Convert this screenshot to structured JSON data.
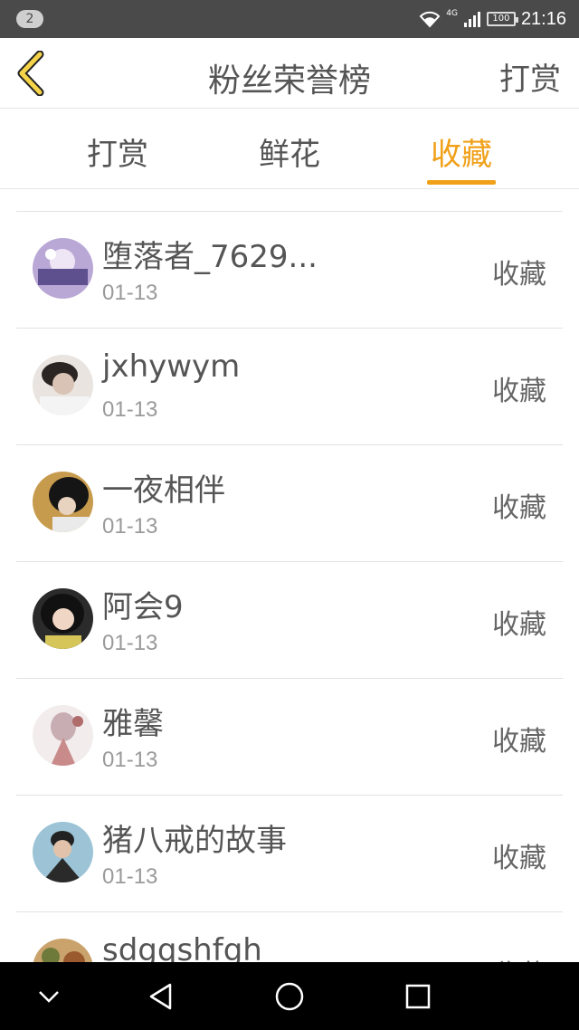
{
  "status_bar": {
    "notification_count": "2",
    "network": "4G",
    "battery": "100",
    "time": "21:16"
  },
  "header": {
    "title": "粉丝荣誉榜",
    "action": "打赏"
  },
  "tabs": [
    {
      "label": "打赏",
      "active": false
    },
    {
      "label": "鲜花",
      "active": false
    },
    {
      "label": "收藏",
      "active": true
    }
  ],
  "accent_color": "#f0a019",
  "list": {
    "items": [
      {
        "name": "堕落者_7629...",
        "date": "01-13",
        "gift": "收藏"
      },
      {
        "name": "jxhywym",
        "date": "01-13",
        "gift": "收藏"
      },
      {
        "name": "一夜相伴",
        "date": "01-13",
        "gift": "收藏"
      },
      {
        "name": "阿会9",
        "date": "01-13",
        "gift": "收藏"
      },
      {
        "name": "雅馨",
        "date": "01-13",
        "gift": "收藏"
      },
      {
        "name": "猪八戒的故事",
        "date": "01-13",
        "gift": "收藏"
      },
      {
        "name": "sdgqshfgh",
        "date": "",
        "gift": "收藏"
      }
    ]
  },
  "nav_bar": {
    "icons": [
      "chevron-down-icon",
      "back-triangle-icon",
      "home-circle-icon",
      "recents-square-icon"
    ]
  }
}
